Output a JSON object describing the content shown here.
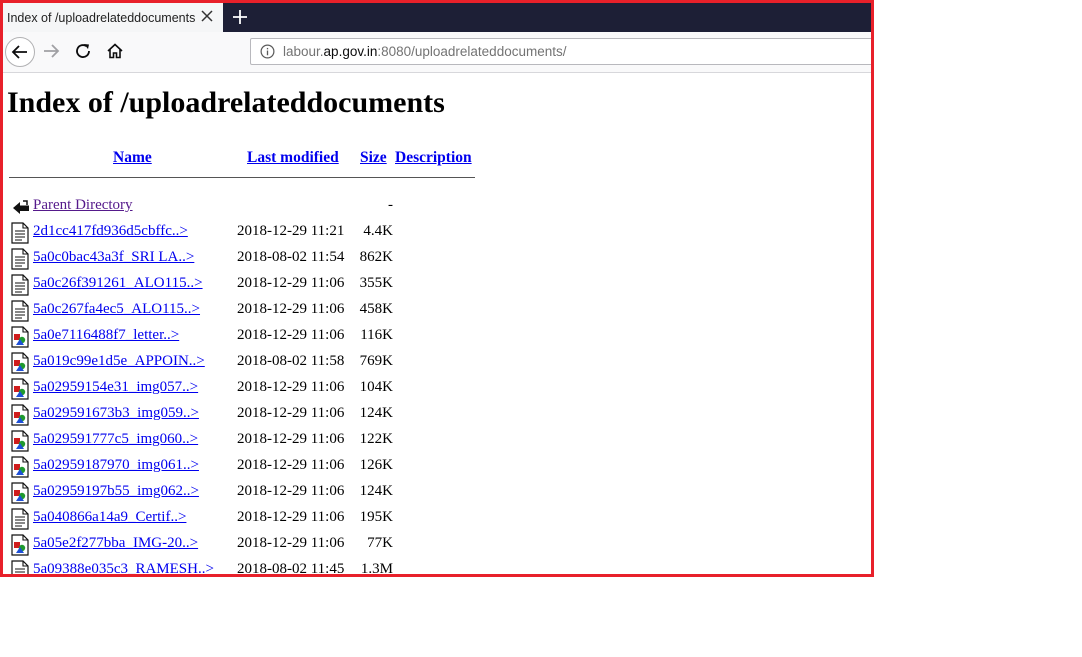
{
  "tab": {
    "title": "Index of /uploadrelateddocuments"
  },
  "urlbar": {
    "host_prefix": "labour.",
    "host": "ap.gov.in",
    "rest": ":8080/uploadrelateddocuments/"
  },
  "page": {
    "title": "Index of /uploadrelateddocuments",
    "headers": {
      "name": "Name",
      "modified": "Last modified",
      "size": "Size",
      "description": "Description"
    },
    "parent": {
      "label": "Parent Directory",
      "size": "-"
    },
    "rows": [
      {
        "name": "2d1cc417fd936d5cbffc..>",
        "modified": "2018-12-29 11:21",
        "size": "4.4K",
        "icon": "text-file-icon"
      },
      {
        "name": "5a0c0bac43a3f_SRI LA..>",
        "modified": "2018-08-02 11:54",
        "size": "862K",
        "icon": "text-file-icon"
      },
      {
        "name": "5a0c26f391261_ALO115..>",
        "modified": "2018-12-29 11:06",
        "size": "355K",
        "icon": "text-file-icon"
      },
      {
        "name": "5a0c267fa4ec5_ALO115..>",
        "modified": "2018-12-29 11:06",
        "size": "458K",
        "icon": "text-file-icon"
      },
      {
        "name": "5a0e7116488f7_letter..>",
        "modified": "2018-12-29 11:06",
        "size": "116K",
        "icon": "image-file-icon"
      },
      {
        "name": "5a019c99e1d5e_APPOIN..>",
        "modified": "2018-08-02 11:58",
        "size": "769K",
        "icon": "image-file-icon"
      },
      {
        "name": "5a02959154e31_img057..>",
        "modified": "2018-12-29 11:06",
        "size": "104K",
        "icon": "image-file-icon"
      },
      {
        "name": "5a029591673b3_img059..>",
        "modified": "2018-12-29 11:06",
        "size": "124K",
        "icon": "image-file-icon"
      },
      {
        "name": "5a029591777c5_img060..>",
        "modified": "2018-12-29 11:06",
        "size": "122K",
        "icon": "image-file-icon"
      },
      {
        "name": "5a02959187970_img061..>",
        "modified": "2018-12-29 11:06",
        "size": "126K",
        "icon": "image-file-icon"
      },
      {
        "name": "5a02959197b55_img062..>",
        "modified": "2018-12-29 11:06",
        "size": "124K",
        "icon": "image-file-icon"
      },
      {
        "name": "5a040866a14a9_Certif..>",
        "modified": "2018-12-29 11:06",
        "size": "195K",
        "icon": "text-file-icon"
      },
      {
        "name": "5a05e2f277bba_IMG-20..>",
        "modified": "2018-12-29 11:06",
        "size": "77K",
        "icon": "image-file-icon"
      },
      {
        "name": "5a09388e035c3_RAMESH..>",
        "modified": "2018-08-02 11:45",
        "size": "1.3M",
        "icon": "text-file-icon"
      }
    ]
  }
}
